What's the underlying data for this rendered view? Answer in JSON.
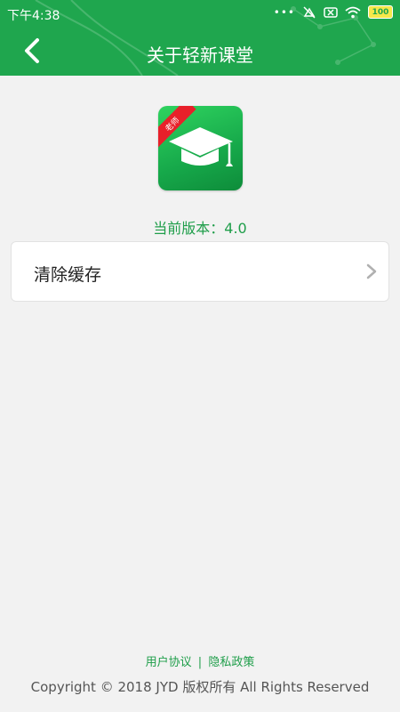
{
  "status_bar": {
    "time": "下午4:38",
    "battery": "100"
  },
  "header": {
    "title": "关于轻新课堂"
  },
  "app": {
    "logo_badge": "老师",
    "version_text": "当前版本：4.0"
  },
  "settings": {
    "clear_cache_label": "清除缓存"
  },
  "footer": {
    "user_agreement": "用户协议",
    "separator": "|",
    "privacy_policy": "隐私政策",
    "copyright": "Copyright © 2018 JYD 版权所有 All Rights Reserved"
  },
  "colors": {
    "brand_green": "#1fa64e",
    "ribbon_red": "#e8202a"
  }
}
